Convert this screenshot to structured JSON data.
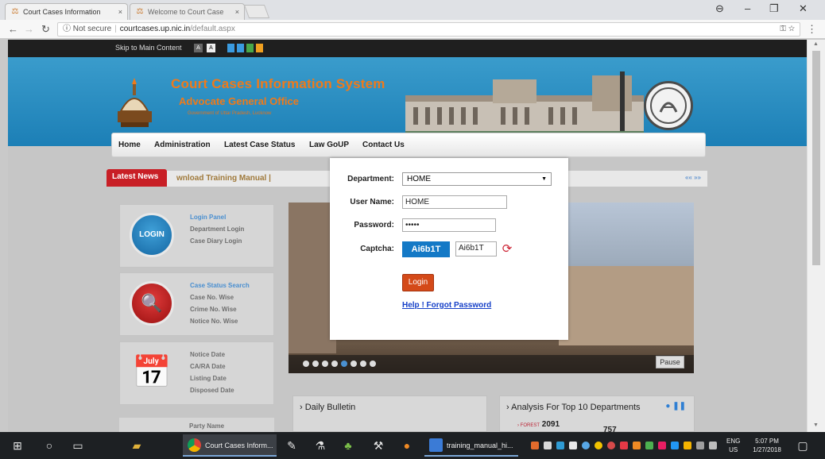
{
  "browser": {
    "tabs": [
      {
        "title": "Court Cases Information",
        "close": "×"
      },
      {
        "title": "Welcome to Court Case",
        "close": "×"
      }
    ],
    "address": {
      "security": "Not secure",
      "host": "courtcases.up.nic.in",
      "path": "/default.aspx"
    }
  },
  "accessibility": {
    "skip_link": "Skip to Main Content",
    "font_small": "A",
    "font_large": "A"
  },
  "header": {
    "title": "Court Cases Information System",
    "subtitle": "Advocate General Office",
    "org": "Government of Uttar Pradesh, Lucknow"
  },
  "nav": {
    "items": [
      "Home",
      "Administration",
      "Latest Case Status",
      "Law GoUP",
      "Contact Us"
    ]
  },
  "news": {
    "label": "Latest News",
    "ticker": "wnload Training Manual  |",
    "controls": "«« »»"
  },
  "panels": [
    {
      "icon_text": "LOGIN",
      "lines": [
        "Login Panel",
        "Department Login",
        "",
        "Case Diary Login"
      ]
    },
    {
      "lines": [
        "Case Status Search",
        "Case No. Wise",
        "Crime No. Wise",
        "Notice No. Wise"
      ]
    },
    {
      "lines": [
        "Notice Date",
        "CA/RA Date",
        "Listing Date",
        "Disposed Date"
      ]
    }
  ],
  "party": {
    "label": "Party Name"
  },
  "slider": {
    "pause_label": "Pause"
  },
  "bulletin": {
    "title": "› Daily Bulletin"
  },
  "analysis": {
    "title": "› Analysis For Top 10 Departments",
    "controls": "● ❚❚",
    "row1_name": "› FOREST",
    "row1_value": "2091",
    "row2_value": "757"
  },
  "login": {
    "department_label": "Department:",
    "department_value": "HOME",
    "username_label": "User Name:",
    "username_value": "HOME",
    "password_label": "Password:",
    "password_value": "•••••",
    "captcha_label": "Captcha:",
    "captcha_code": "Ai6b1T",
    "captcha_input": "Ai6b1T",
    "login_button": "Login",
    "help_link": "Help ! Forgot Password"
  },
  "taskbar": {
    "apps": [
      {
        "label": "Court Cases Inform..."
      },
      {
        "label": "training_manual_hi..."
      }
    ],
    "lang_top": "ENG",
    "lang_bottom": "US",
    "time": "5:07 PM",
    "date": "1/27/2018"
  }
}
